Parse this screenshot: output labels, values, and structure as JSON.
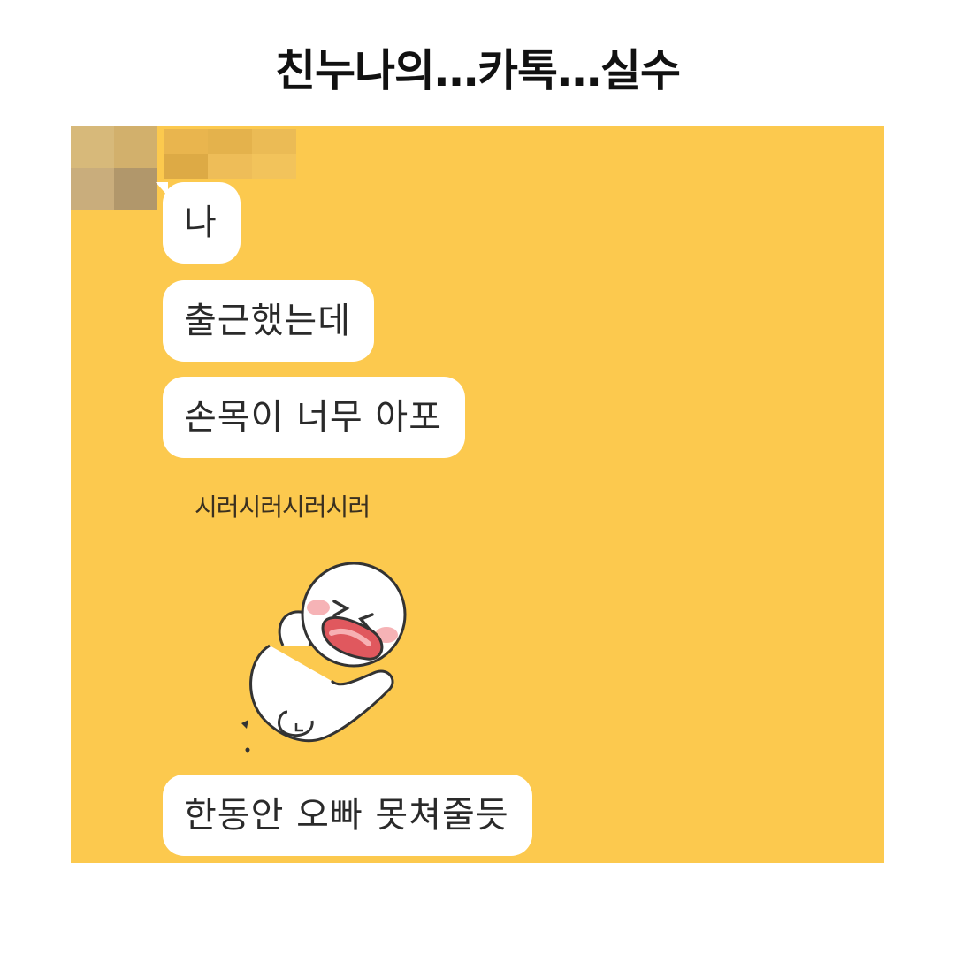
{
  "header": {
    "title": "친누나의…카톡…실수"
  },
  "chat": {
    "background_color": "#fcc94e",
    "bubble_color": "#ffffff",
    "messages": [
      {
        "text": "나"
      },
      {
        "text": "출근했는데"
      },
      {
        "text": "손목이 너무 아포"
      }
    ],
    "sticker": {
      "caption": "시러시러시러시러",
      "icon": "crying-character-sticker"
    },
    "last_message": {
      "text": "한동안 오빠 못쳐줄듯"
    }
  }
}
